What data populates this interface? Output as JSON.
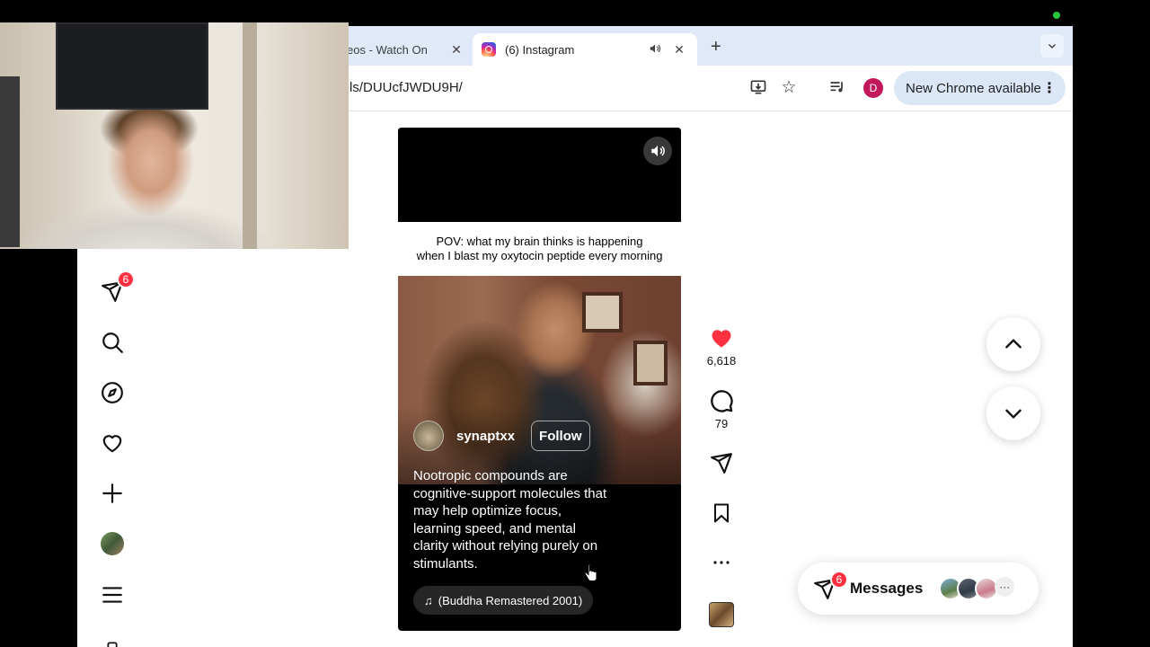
{
  "browser": {
    "tabs": [
      {
        "title": "eos - Watch On",
        "active": false
      },
      {
        "title": "(6) Instagram",
        "active": true
      }
    ],
    "url": "ls/DUUcfJWDU9H/",
    "profile_initial": "D",
    "update_label": "New Chrome available"
  },
  "sidebar": {
    "messages_badge": "6",
    "items": [
      "messages-icon",
      "search-icon",
      "explore-icon",
      "heart-icon",
      "create-icon",
      "profile-avatar",
      "menu-icon"
    ]
  },
  "reel": {
    "caption_line1": "POV: what my brain thinks is happening",
    "caption_line2": "when I blast my oxytocin peptide every morning",
    "author": "synaptxx",
    "follow_label": "Follow",
    "description": "Nootropic compounds are cognitive-support molecules that may help optimize focus, learning speed, and mental clarity without relying purely on stimulants.",
    "audio": "(Buddha Remastered 2001)"
  },
  "actions": {
    "likes": "6,618",
    "comments": "79"
  },
  "messages_pill": {
    "label": "Messages",
    "badge": "6",
    "more": "···"
  },
  "colors": {
    "like_red": "#ff3040",
    "badge_red": "#ff3040",
    "chrome_tabstrip": "#dfe9f8",
    "update_chip": "#dbe6f7",
    "avatar_magenta": "#c2185b"
  }
}
